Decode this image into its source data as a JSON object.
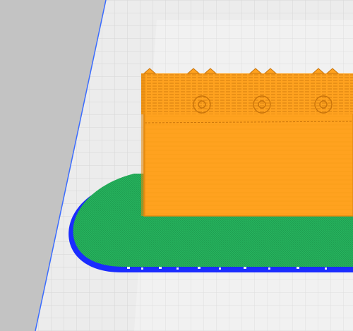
{
  "viewport": {
    "colors": {
      "background": "#c3c3c3",
      "plate_light": "#ececec",
      "plate_grid": "#dcdcdc",
      "plate_edge": "#3b6cff",
      "raft_green": "#26b25d",
      "raft_green_dark": "#1a8c46",
      "brim_blue": "#1a2cff",
      "model_orange": "#ffa21f",
      "model_orange_dark": "#e38a10",
      "model_orange_light": "#ffb347"
    }
  }
}
